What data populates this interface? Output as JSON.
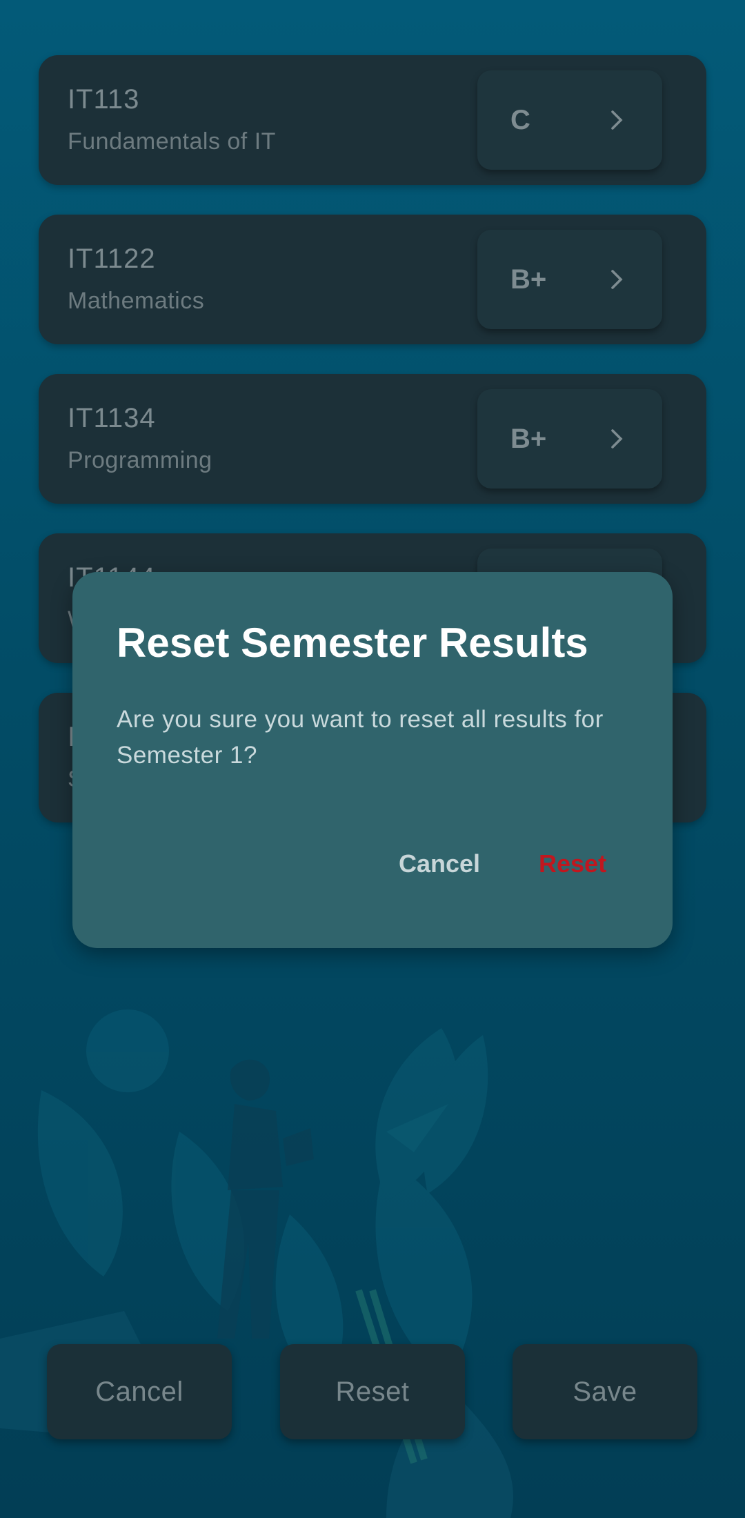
{
  "courses": [
    {
      "code": "IT113",
      "name": "Fundamentals of IT",
      "grade": "C"
    },
    {
      "code": "IT1122",
      "name": "Mathematics",
      "grade": "B+"
    },
    {
      "code": "IT1134",
      "name": "Programming",
      "grade": "B+"
    },
    {
      "code": "IT1144",
      "name": "W",
      "grade": ""
    },
    {
      "code": "I",
      "name": "S",
      "grade": ""
    }
  ],
  "dialog": {
    "title": "Reset Semester Results",
    "message": "Are you sure you want to reset all results for Semester 1?",
    "cancel_label": "Cancel",
    "reset_label": "Reset"
  },
  "bottom_bar": {
    "cancel_label": "Cancel",
    "reset_label": "Reset",
    "save_label": "Save"
  },
  "colors": {
    "background": "#035a78",
    "card": "#1c3038",
    "dialog": "#30646c",
    "danger": "#c0171f"
  }
}
